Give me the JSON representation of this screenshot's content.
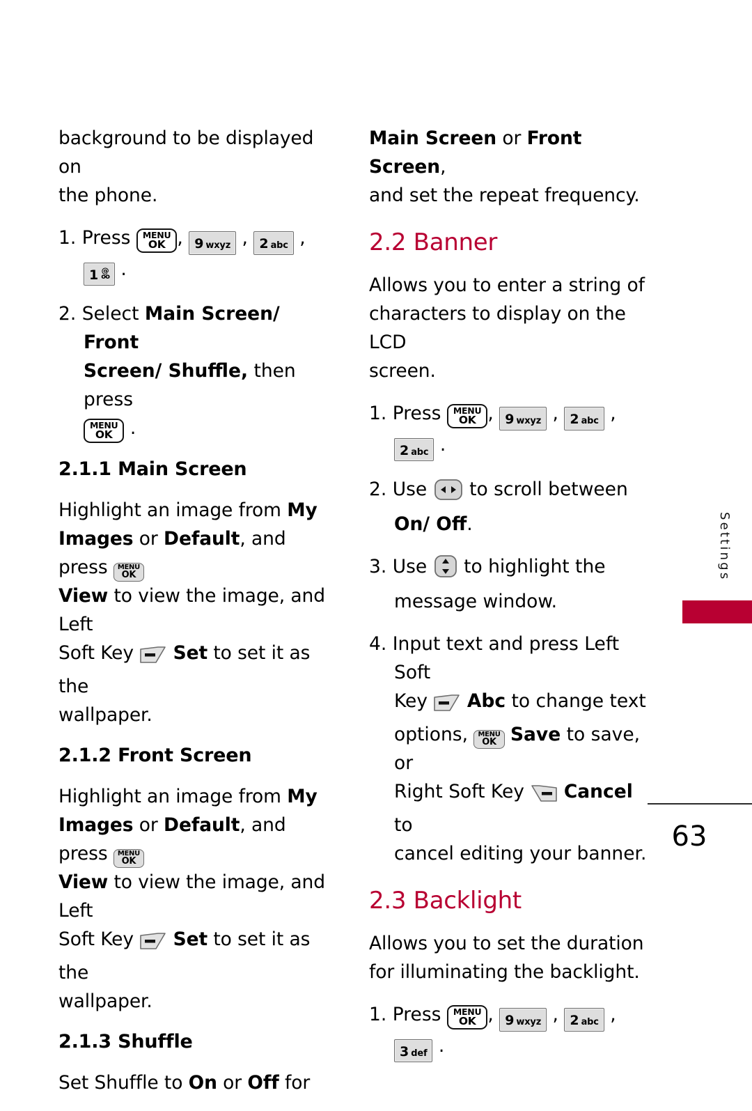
{
  "page": {
    "number": "63",
    "accent_color": "#B80032",
    "key_fill": "#dedede",
    "key_border": "#6d6d6d"
  },
  "side_tab": {
    "label": "Settings"
  },
  "keys": {
    "menu_ok": {
      "line1": "MENU",
      "line2": "OK"
    },
    "nine": {
      "digit": "9",
      "letters": "wxyz"
    },
    "two": {
      "digit": "2",
      "letters": "abc"
    },
    "three": {
      "digit": "3",
      "letters": "def"
    },
    "one": {
      "digit": "1",
      "at": "@",
      "voicemail": "oo"
    }
  },
  "left_column": {
    "intro": {
      "text_1": "background to be displayed on",
      "text_2": "the phone."
    },
    "step1": {
      "num": "1.",
      "press": "Press",
      "comma": ",",
      "period": "."
    },
    "step2": {
      "num": "2.",
      "lead": "Select ",
      "bold_1": "Main Screen/ Front",
      "bold_2": "Screen/ Shuffle,",
      "after": " then press",
      "period": "."
    },
    "section_211": {
      "heading": "2.1.1 Main Screen",
      "t1": "Highlight an image from ",
      "b1": "My",
      "b2": "Images",
      "t2": " or ",
      "b3": "Default",
      "t3": ", and press ",
      "b4": "View",
      "t4": " to view the image, and Left",
      "t5": "Soft Key ",
      "b5": "Set",
      "t6": " to set it as the",
      "t7": "wallpaper."
    },
    "section_212": {
      "heading": "2.1.2 Front Screen",
      "t1": "Highlight an image from ",
      "b1": "My",
      "b2": "Images",
      "t2": " or ",
      "b3": "Default",
      "t3": ", and press ",
      "b4": "View",
      "t4": " to view the image, and Left",
      "t5": "Soft Key ",
      "b5": "Set",
      "t6": " to set it as the",
      "t7": "wallpaper."
    },
    "section_213": {
      "heading": "2.1.3 Shuffle",
      "t1": "Set Shuffle to ",
      "b1": "On",
      "t2": " or ",
      "b2": "Off",
      "t3": " for"
    }
  },
  "right_column": {
    "continued": {
      "b1": "Main Screen",
      "t1": " or ",
      "b2": "Front Screen",
      "t2": ",",
      "t3": "and set the repeat frequency."
    },
    "section_22": {
      "heading": "2.2 Banner",
      "intro_1": "Allows you to enter a string of",
      "intro_2": "characters to display on the LCD",
      "intro_3": "screen.",
      "step1": {
        "num": "1.",
        "press": "Press",
        "comma": ",",
        "period": "."
      },
      "step2": {
        "num": "2.",
        "t1": "Use ",
        "t2": " to scroll between",
        "b1": "On/ Off",
        "t3": "."
      },
      "step3": {
        "num": "3.",
        "t1": "Use ",
        "t2": " to highlight the",
        "t3": "message window."
      },
      "step4": {
        "num": "4.",
        "t1": "Input text and press Left Soft",
        "t2": "Key ",
        "b1": "Abc",
        "t3": " to change text",
        "t4": "options, ",
        "b2": "Save",
        "t5": " to save, or",
        "t6": "Right Soft Key ",
        "b3": "Cancel",
        "t7": " to",
        "t8": "cancel editing your banner."
      }
    },
    "section_23": {
      "heading": "2.3 Backlight",
      "intro_1": "Allows you to set the duration",
      "intro_2": "for illuminating the backlight.",
      "step1": {
        "num": "1.",
        "press": "Press",
        "comma": ",",
        "period": "."
      }
    }
  }
}
